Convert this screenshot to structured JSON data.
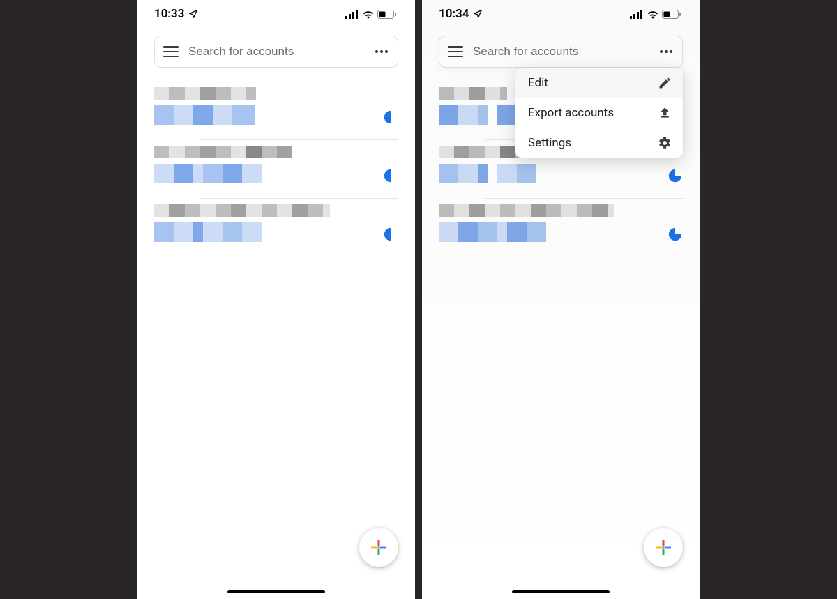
{
  "left": {
    "status_time": "10:33",
    "search_placeholder": "Search for accounts"
  },
  "right": {
    "status_time": "10:34",
    "search_placeholder": "Search for accounts",
    "menu": {
      "edit": "Edit",
      "export": "Export accounts",
      "settings": "Settings"
    }
  }
}
